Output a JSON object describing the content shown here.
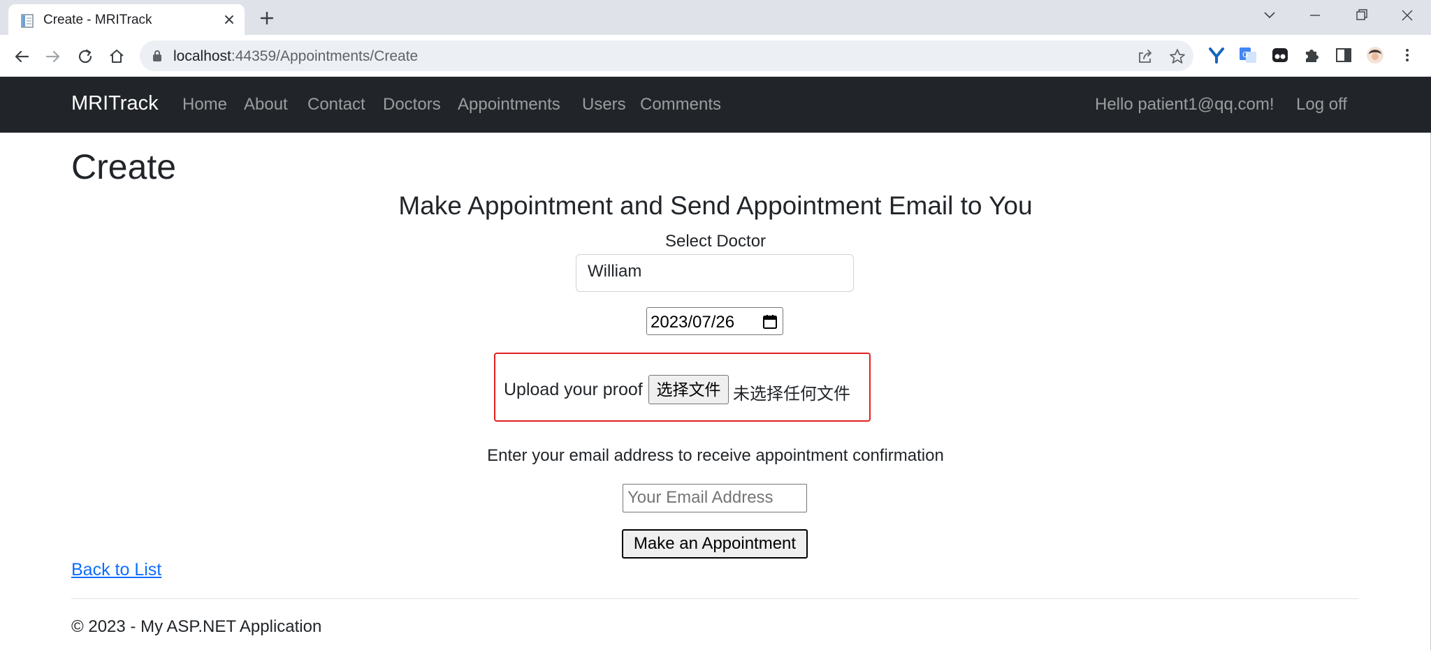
{
  "browser": {
    "tab_title": "Create - MRITrack",
    "url_host": "localhost",
    "url_path": ":44359/Appointments/Create"
  },
  "nav": {
    "brand": "MRITrack",
    "links": [
      "Home",
      "About",
      "Contact",
      "Doctors",
      "Appointments",
      "Users",
      "Comments"
    ],
    "greeting": "Hello patient1@qq.com!",
    "logoff": "Log off"
  },
  "page": {
    "title": "Create",
    "form_heading": "Make Appointment and Send Appointment Email to You",
    "select_doctor_label": "Select Doctor",
    "doctor_value": "William",
    "date_value": "2023/07/26",
    "upload_label": "Upload your proof",
    "choose_file_label": "选择文件",
    "no_file_text": "未选择任何文件",
    "email_label": "Enter your email address to receive appointment confirmation",
    "email_placeholder": "Your Email Address",
    "submit_label": "Make an Appointment",
    "back_link": "Back to List",
    "footer": "© 2023 - My ASP.NET Application"
  },
  "colors": {
    "navbar_bg": "#212529",
    "highlight_border": "#e02020",
    "link": "#0d6efd"
  },
  "icons": [
    "document-favicon-icon",
    "close-icon",
    "plus-icon",
    "chevron-down-icon",
    "minimize-icon",
    "restore-icon",
    "close-window-icon",
    "back-arrow-icon",
    "forward-arrow-icon",
    "reload-icon",
    "home-icon",
    "lock-icon",
    "share-icon",
    "star-icon",
    "calendar-icon"
  ]
}
